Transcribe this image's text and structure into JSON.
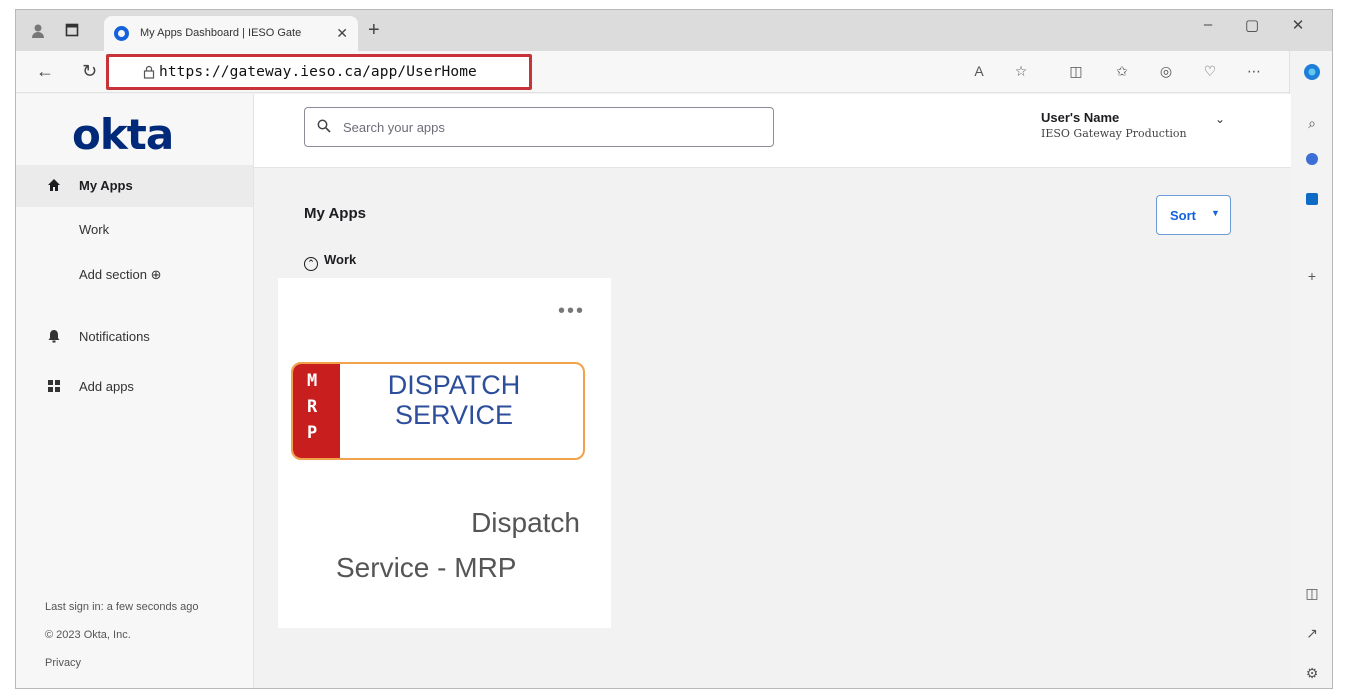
{
  "browser": {
    "tab_title": "My Apps Dashboard | IESO Gate",
    "url": "https://gateway.ieso.ca/app/UserHome"
  },
  "okta": {
    "logo": "okta",
    "search": {
      "placeholder": "Search your apps"
    },
    "user": {
      "name": "User's Name",
      "org": "IESO Gateway Production"
    },
    "nav": {
      "my_apps": "My Apps",
      "work": "Work",
      "add_section": "Add section",
      "notifications": "Notifications",
      "add_apps": "Add apps"
    },
    "footer": {
      "last_sign_in": "Last sign in: a few seconds ago",
      "copyright": "© 2023 Okta, Inc.",
      "privacy": "Privacy"
    },
    "main": {
      "title": "My Apps",
      "sort_label": "Sort",
      "group_label": "Work",
      "app": {
        "logo_letters": [
          "M",
          "R",
          "P"
        ],
        "logo_line1": "DISPATCH",
        "logo_line2": "SERVICE",
        "title_line1": "Dispatch",
        "title_line2": "Service - MRP"
      }
    }
  },
  "colors": {
    "okta_blue": "#00297a",
    "link_blue": "#1662dd",
    "highlight_red": "#c8333a",
    "mrp_red": "#c81e1e",
    "logo_orange": "#f2a24a"
  }
}
